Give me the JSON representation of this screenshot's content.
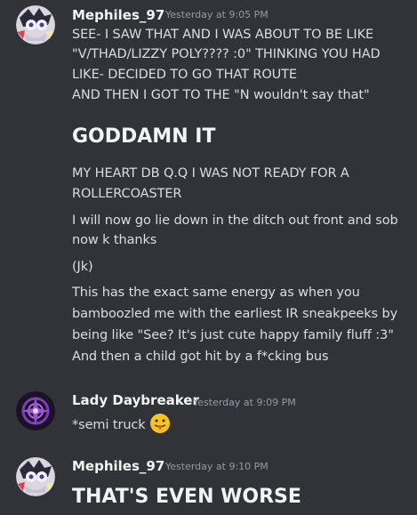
{
  "colors": {
    "background": "#313338",
    "text": "#dbdee1",
    "username": "#f2f3f5",
    "timestamp": "#949ba4"
  },
  "messages": [
    {
      "author": "Mephiles_97",
      "timestamp": "Yesterday at 9:05 PM",
      "avatar_icon": "mephiles-avatar-icon",
      "lines": [
        "SEE- I SAW THAT AND I WAS ABOUT TO BE LIKE",
        "\"V/THAD/LIZZY POLY???? :0\" THINKING YOU HAD",
        "LIKE- DECIDED TO GO THAT ROUTE",
        "AND THEN I GOT TO THE \"N wouldn't say that\""
      ],
      "heading": "GODDAMN IT",
      "lines2": [
        "MY HEART DB Q.Q I WAS NOT READY FOR A",
        "ROLLERCOASTER"
      ],
      "lines3": [
        "I will now go lie down in the ditch out front and sob",
        "now k thanks"
      ],
      "lines4": [
        "(Jk)"
      ],
      "lines5": [
        "This has the exact same energy as when you",
        "bamboozled me with the earliest IR sneakpeeks by",
        "being like \"See? It's just cute happy family fluff :3\"",
        "And then a child got hit by a f*cking bus"
      ]
    },
    {
      "author": "Lady Daybreaker",
      "timestamp": "Yesterday at 9:09 PM",
      "avatar_icon": "lady-daybreaker-avatar-icon",
      "text": "*semi truck",
      "emoji": "tongue-out-emoji"
    },
    {
      "author": "Mephiles_97",
      "timestamp": "Yesterday at 9:10 PM",
      "avatar_icon": "mephiles-avatar-icon",
      "heading": "THAT'S EVEN WORSE"
    }
  ]
}
